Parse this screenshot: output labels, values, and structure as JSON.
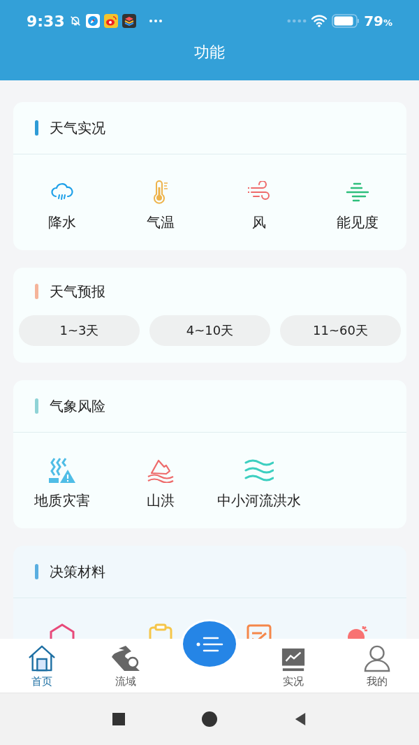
{
  "status_bar": {
    "time": "9:33",
    "battery": "79",
    "battery_unit": "%"
  },
  "header": {
    "title": "功能"
  },
  "sections": [
    {
      "kind": "grid",
      "title": "天气实况",
      "color": "#2e9bd6",
      "items": [
        {
          "label": "降水"
        },
        {
          "label": "气温"
        },
        {
          "label": "风"
        },
        {
          "label": "能见度"
        }
      ]
    },
    {
      "kind": "buttons",
      "title": "天气预报",
      "color": "#f5b49a",
      "items": [
        {
          "label": "1~3天"
        },
        {
          "label": "4~10天"
        },
        {
          "label": "11~60天"
        }
      ]
    },
    {
      "kind": "grid",
      "title": "气象风险",
      "color": "#8fd3d6",
      "items": [
        {
          "label": "地质灾害"
        },
        {
          "label": "山洪"
        },
        {
          "label": "中小河流洪水"
        }
      ]
    },
    {
      "kind": "icons_cut",
      "title": "决策材料",
      "color": "#5aaee0"
    }
  ],
  "tab_bar": [
    {
      "kind": "tab",
      "label": "首页",
      "selected": true
    },
    {
      "kind": "tab",
      "label": "流域",
      "selected": false
    },
    {
      "kind": "fab",
      "selected": false
    },
    {
      "kind": "tab",
      "label": "实况",
      "selected": false
    },
    {
      "kind": "tab",
      "label": "我的",
      "selected": false
    }
  ]
}
